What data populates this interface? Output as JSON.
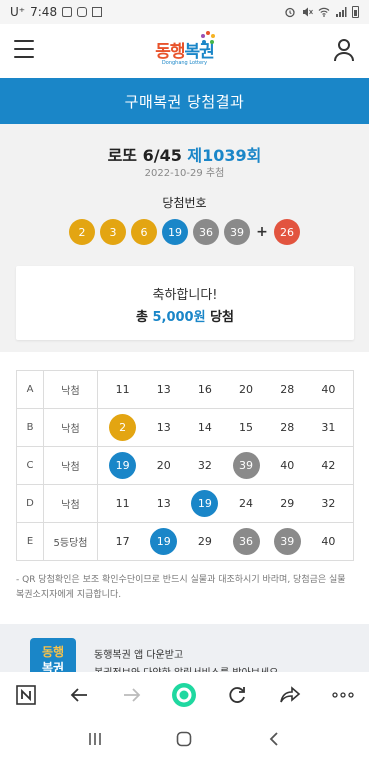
{
  "status_bar": {
    "carrier": "U⁺",
    "time": "7:48",
    "icons": [
      "image-icon",
      "instagram-icon",
      "n-icon",
      "alarm-icon",
      "mute-icon",
      "wifi-icon",
      "signal-icon",
      "battery-icon"
    ]
  },
  "header": {
    "logo_main_a": "동행",
    "logo_main_b": "복권",
    "logo_sub": "Donghang Lottery",
    "menu_icon": "hamburger-menu-icon",
    "user_icon": "user-icon"
  },
  "page_title": "구매복권 당첨결과",
  "round": {
    "game": "로또 6/45",
    "round_label": "제1039회",
    "date": "2022-10-29 추첨"
  },
  "winning": {
    "label": "당첨번호",
    "numbers": [
      "2",
      "3",
      "6",
      "19",
      "36",
      "39"
    ],
    "plus": "+",
    "bonus": "26",
    "colors": {
      "yellow": "#e3a512",
      "blue": "#1a86c8",
      "gray": "#8a8a8a",
      "red": "#e2543f"
    }
  },
  "congrats": {
    "message": "축하합니다!",
    "prefix": "총",
    "amount": "5,000원",
    "suffix": "당첨"
  },
  "rows": [
    {
      "label": "A",
      "status": "낙첨",
      "nums": [
        "11",
        "13",
        "16",
        "20",
        "28",
        "40"
      ],
      "hits": []
    },
    {
      "label": "B",
      "status": "낙첨",
      "nums": [
        "2",
        "13",
        "14",
        "15",
        "28",
        "31"
      ],
      "hits": [
        "y"
      ]
    },
    {
      "label": "C",
      "status": "낙첨",
      "nums": [
        "19",
        "20",
        "32",
        "39",
        "40",
        "42"
      ],
      "hits": [
        "b",
        "",
        "",
        "g"
      ]
    },
    {
      "label": "D",
      "status": "낙첨",
      "nums": [
        "11",
        "13",
        "19",
        "24",
        "29",
        "32"
      ],
      "hits": [
        "",
        "",
        "b"
      ]
    },
    {
      "label": "E",
      "status": "5등당첨",
      "nums": [
        "17",
        "19",
        "29",
        "36",
        "39",
        "40"
      ],
      "hits": [
        "",
        "b",
        "",
        "g",
        "g"
      ]
    }
  ],
  "note": "- QR 당첨확인은 보조 확인수단이므로 반드시 실물과 대조하시기 바라며, 당첨금은 실물 복권소지자에게 지급합니다.",
  "app_banner": {
    "logo_a": "동행",
    "logo_b": "복권",
    "line1": "동행복권 앱 다운받고",
    "line2": "복권정보와 다양한 알림서비스를 받아보세요"
  },
  "browser_bar": {
    "icons": [
      "naver-n-icon",
      "back-arrow-icon",
      "forward-arrow-icon",
      "home-circle-icon",
      "refresh-icon",
      "share-icon",
      "more-icon"
    ]
  },
  "android_nav": {
    "icons": [
      "recent-apps-icon",
      "home-icon",
      "back-icon"
    ]
  }
}
